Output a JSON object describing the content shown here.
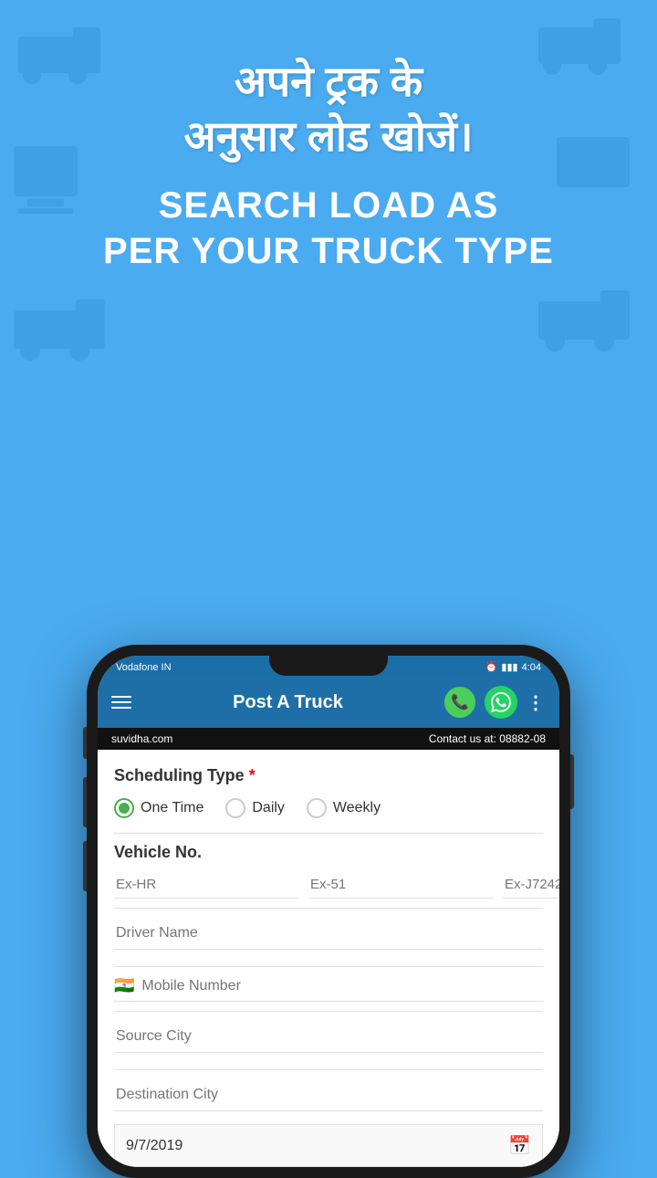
{
  "background": {
    "color": "#4aabf0"
  },
  "top_section": {
    "hindi_title": "अपने ट्रक के\nअनुसार लोड खोजें।",
    "english_title": "SEARCH LOAD AS\nPER YOUR TRUCK TYPE"
  },
  "status_bar": {
    "carrier": "Vodafone IN",
    "time": "4:04",
    "alarm_icon": "alarm-icon",
    "battery_icon": "battery-icon"
  },
  "header": {
    "title": "Post A Truck",
    "menu_icon": "menu-icon",
    "phone_icon": "phone-icon",
    "whatsapp_icon": "whatsapp-icon",
    "more_icon": "more-options-icon"
  },
  "contact_bar": {
    "website": "suvidha.com",
    "contact": "Contact us at: 08882-08"
  },
  "form": {
    "scheduling_type": {
      "label": "Scheduling Type",
      "required": true,
      "options": [
        {
          "id": "one_time",
          "label": "One Time",
          "selected": true
        },
        {
          "id": "daily",
          "label": "Daily",
          "selected": false
        },
        {
          "id": "weekly",
          "label": "Weekly",
          "selected": false
        }
      ]
    },
    "vehicle_no": {
      "label": "Vehicle No.",
      "placeholder_1": "Ex-HR",
      "placeholder_2": "Ex-51",
      "placeholder_3": "Ex-J7242"
    },
    "driver_name": {
      "placeholder": "Driver Name"
    },
    "mobile_number": {
      "placeholder": "Mobile Number",
      "flag": "🇮🇳"
    },
    "source_city": {
      "placeholder": "Source City"
    },
    "destination_city": {
      "placeholder": "Destination City"
    },
    "date": {
      "value": "9/7/2019"
    }
  }
}
